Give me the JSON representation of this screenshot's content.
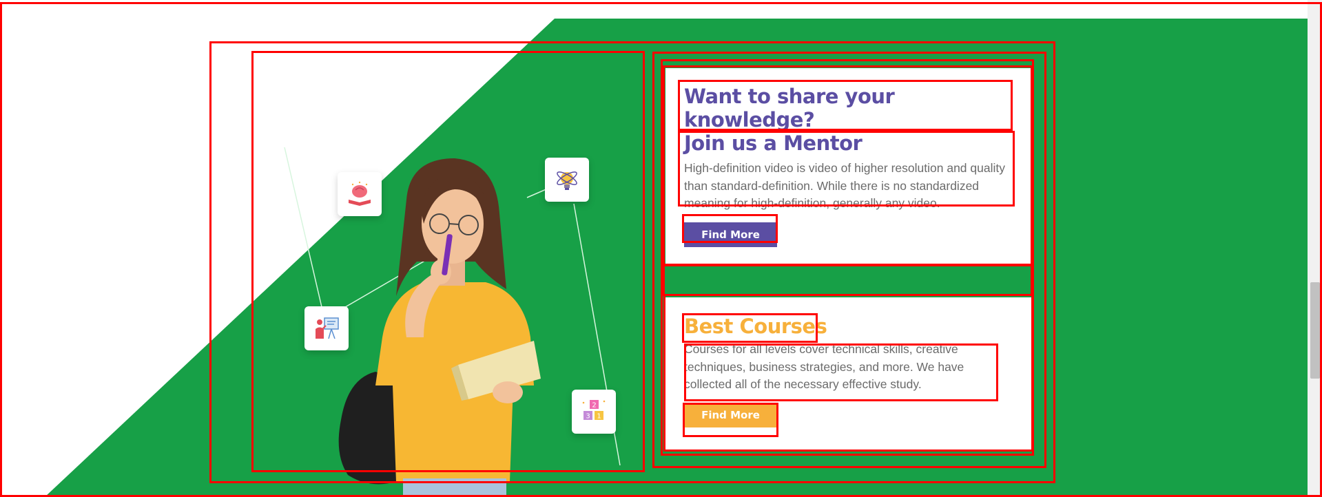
{
  "colors": {
    "green": "#17a047",
    "purple": "#5b4ea3",
    "orange": "#f7b03b",
    "highlight": "#ff0000"
  },
  "illustration": {
    "icons": [
      "brain-book-icon",
      "lightbulb-atom-icon",
      "teacher-board-icon",
      "number-blocks-icon"
    ],
    "block_digits": [
      "2",
      "3",
      "1"
    ]
  },
  "mentor_card": {
    "title_line1": "Want to share your knowledge?",
    "title_line2": "Join us a Mentor",
    "description": "High-definition video is video of higher resolution and quality than standard-definition. While there is no standardized meaning for high-definition, generally any video.",
    "button_label": "Find More"
  },
  "courses_card": {
    "title": "Best Courses",
    "description": "Courses for all levels cover technical skills, creative techniques, business strategies, and more. We have collected all of the necessary effective study.",
    "button_label": "Find More"
  }
}
